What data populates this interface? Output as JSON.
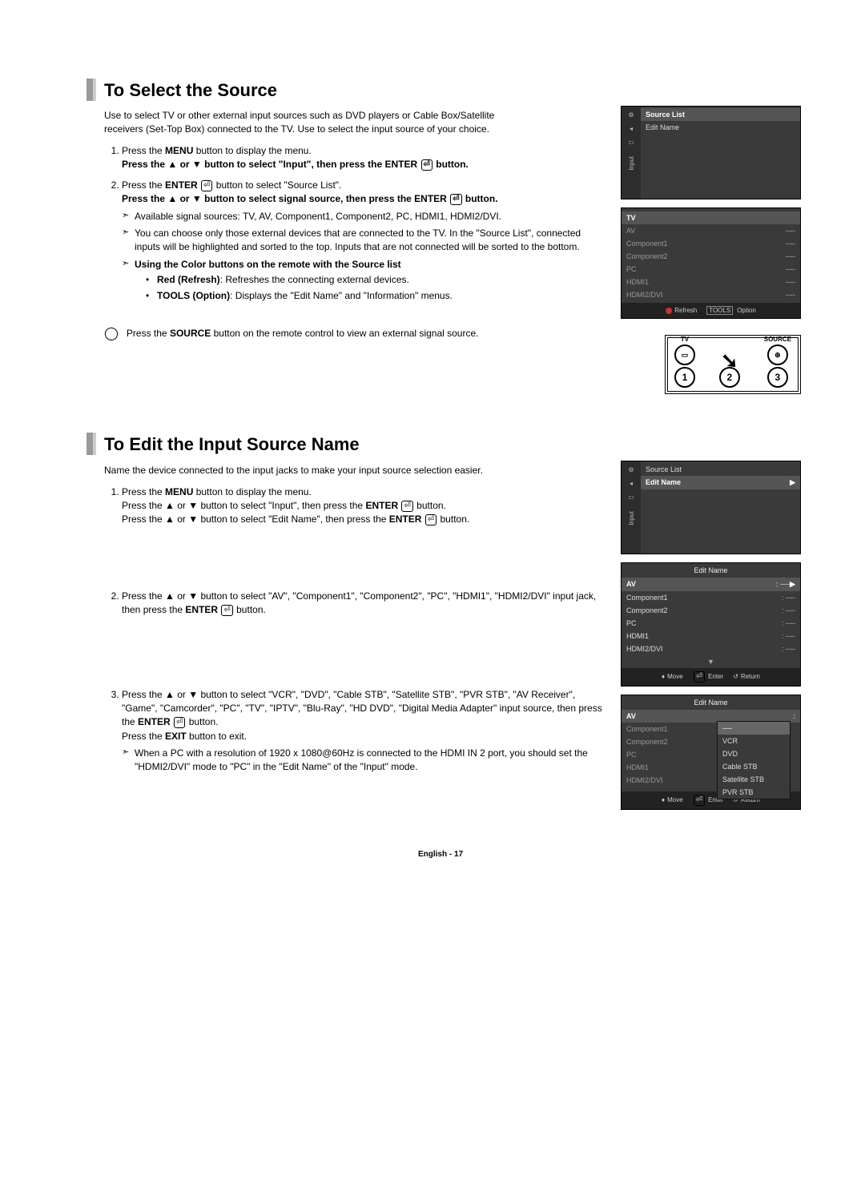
{
  "section1": {
    "title": "To Select the Source",
    "intro": "Use to select TV or other external input sources such as DVD players or Cable Box/Satellite receivers (Set-Top Box) connected to the TV. Use to select the input source of your choice.",
    "step1a": "Press the ",
    "step1a_b": "MENU",
    "step1a2": " button to display the menu.",
    "step1b": "Press the ▲ or ▼ button to select \"Input\", then press the ENTER ",
    "step1b2": " button.",
    "step2a": "Press the ",
    "step2a_b": "ENTER",
    "step2a2": " button to select \"Source List\".",
    "step2b": "Press the ▲ or ▼ button to select signal source, then press the ENTER ",
    "step2b2": " button.",
    "avail": "Available signal sources: TV, AV, Component1, Component2, PC, HDMI1, HDMI2/DVI.",
    "choose": "You can choose only those external devices that are connected to the TV. In the \"Source List\", connected inputs will be highlighted and sorted to the top. Inputs that are not connected will be sorted to the bottom.",
    "colorbtns": "Using the Color buttons on the remote with the Source list",
    "red_b": "Red (Refresh)",
    "red_t": ": Refreshes the connecting external devices.",
    "tools_b": "TOOLS (Option)",
    "tools_t": ": Displays the \"Edit Name\" and \"Information\" menus.",
    "note_b": "SOURCE",
    "note_pre": "Press the ",
    "note_post": " button on the remote control to view an external signal source."
  },
  "osd1": {
    "item1": "Source List",
    "item2": "Edit Name",
    "sidelabel": "Input"
  },
  "osd_source": {
    "rows": [
      "TV",
      "AV",
      "Component1",
      "Component2",
      "PC",
      "HDMI1",
      "HDMI2/DVI"
    ],
    "vals": [
      "",
      "----",
      "----",
      "----",
      "----",
      "----",
      "----"
    ],
    "refresh": "Refresh",
    "option": "Option"
  },
  "remote": {
    "tv": "TV",
    "source": "SOURCE",
    "n1": "1",
    "n2": "2",
    "n3": "3"
  },
  "section2": {
    "title": "To Edit the Input Source Name",
    "intro": "Name the device connected to the input jacks to make your input source selection easier.",
    "s1a": "Press the ",
    "s1a_b": "MENU",
    "s1a2": " button to display the menu.",
    "s1b": "Press the ▲ or ▼ button to select \"Input\", then press the ",
    "s1b_b": "ENTER",
    "s1b2": " button.",
    "s1c": "Press the ▲ or ▼ button to select \"Edit Name\", then press the ",
    "s1c_b": "ENTER",
    "s1c2": " button.",
    "s2": "Press the ▲ or ▼ button to select \"AV\", \"Component1\", \"Component2\", \"PC\", \"HDMI1\", \"HDMI2/DVI\" input jack, then press the ",
    "s2_b": "ENTER",
    "s2_2": " button.",
    "s3": "Press the ▲ or ▼ button to select \"VCR\", \"DVD\", \"Cable STB\", \"Satellite STB\", \"PVR STB\", \"AV Receiver\", \"Game\", \"Camcorder\", \"PC\", \"TV\", \"IPTV\", \"Blu-Ray\", \"HD DVD\", \"Digital Media Adapter\" input source, then press the ",
    "s3_b": "ENTER",
    "s3_2": " button.",
    "s3ex": "Press the ",
    "s3ex_b": "EXIT",
    "s3ex2": " button to exit.",
    "s3note": "When a PC with a resolution of 1920 x 1080@60Hz is connected to the HDMI IN 2 port, you should set the \"HDMI2/DVI\" mode to \"PC\" in the \"Edit Name\" of the \"Input\" mode."
  },
  "osd2": {
    "sidelabel": "Input",
    "i1": "Source List",
    "i2": "Edit Name"
  },
  "osd_edit1": {
    "title": "Edit Name",
    "rows": [
      "AV",
      "Component1",
      "Component2",
      "PC",
      "HDMI1",
      "HDMI2/DVI"
    ],
    "vals": [
      ": ----",
      ": ----",
      ": ----",
      ": ----",
      ": ----",
      ": ----"
    ],
    "move": "Move",
    "enter": "Enter",
    "return": "Return"
  },
  "osd_edit2": {
    "title": "Edit Name",
    "rows": [
      "AV",
      "Component1",
      "Component2",
      "PC",
      "HDMI1",
      "HDMI2/DVI"
    ],
    "dd": [
      "----",
      "VCR",
      "DVD",
      "Cable STB",
      "Satellite STB",
      "PVR STB"
    ],
    "move": "Move",
    "enter": "Enter",
    "return": "Return"
  },
  "footer": "English - 17"
}
